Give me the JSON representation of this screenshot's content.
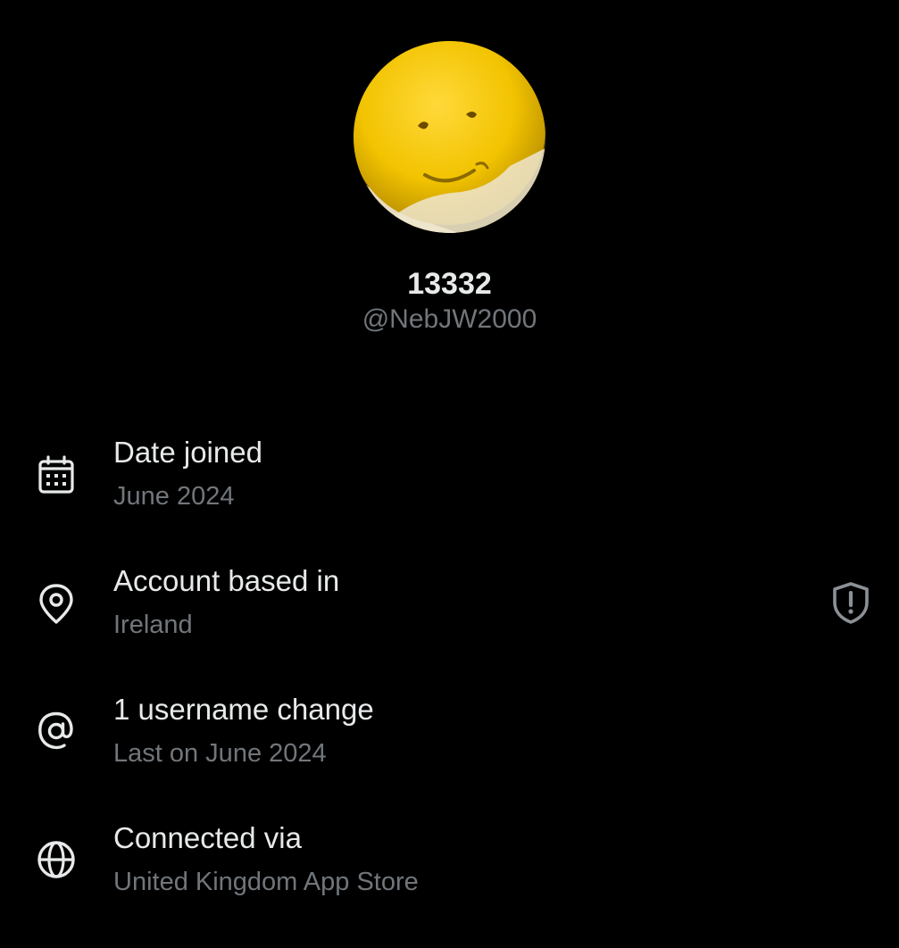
{
  "profile": {
    "display_name": "13332",
    "handle": "@NebJW2000",
    "avatar_icon": "avatar-smiley-yellow"
  },
  "about": {
    "rows": [
      {
        "icon": "calendar-icon",
        "title": "Date joined",
        "subtitle": "June 2024"
      },
      {
        "icon": "location-pin-icon",
        "title": "Account based in",
        "subtitle": "Ireland",
        "trailing_icon": "shield-alert-icon"
      },
      {
        "icon": "at-sign-icon",
        "title": "1 username change",
        "subtitle": "Last on June 2024"
      },
      {
        "icon": "globe-icon",
        "title": "Connected via",
        "subtitle": "United Kingdom App Store"
      }
    ]
  },
  "colors": {
    "background": "#000000",
    "primary_text": "#e7e9ea",
    "secondary_text": "#71767b",
    "avatar_yellow": "#f2c300"
  }
}
